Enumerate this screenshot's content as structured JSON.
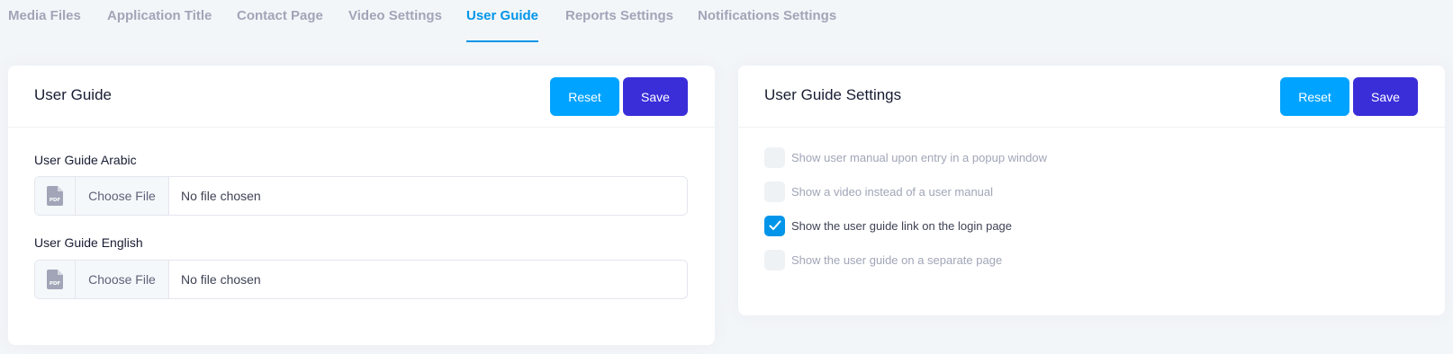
{
  "tabs": [
    {
      "label": "Media Files",
      "active": false
    },
    {
      "label": "Application Title",
      "active": false
    },
    {
      "label": "Contact Page",
      "active": false
    },
    {
      "label": "Video Settings",
      "active": false
    },
    {
      "label": "User Guide",
      "active": true
    },
    {
      "label": "Reports Settings",
      "active": false
    },
    {
      "label": "Notifications Settings",
      "active": false
    }
  ],
  "left_card": {
    "title": "User Guide",
    "reset_label": "Reset",
    "save_label": "Save",
    "fields": [
      {
        "label": "User Guide Arabic",
        "button_label": "Choose File",
        "status": "No file chosen",
        "icon": "pdf-file-icon"
      },
      {
        "label": "User Guide English",
        "button_label": "Choose File",
        "status": "No file chosen",
        "icon": "pdf-file-icon"
      }
    ]
  },
  "right_card": {
    "title": "User Guide Settings",
    "reset_label": "Reset",
    "save_label": "Save",
    "options": [
      {
        "label": "Show user manual upon entry in a popup window",
        "checked": false
      },
      {
        "label": "Show a video instead of a user manual",
        "checked": false
      },
      {
        "label": "Show the user guide link on the login page",
        "checked": true
      },
      {
        "label": "Show the user guide on a separate page",
        "checked": false
      }
    ]
  },
  "colors": {
    "accent": "#0095e8",
    "reset_button": "#00a3ff",
    "save_button": "#3a2ed9",
    "background": "#f3f6f9"
  }
}
